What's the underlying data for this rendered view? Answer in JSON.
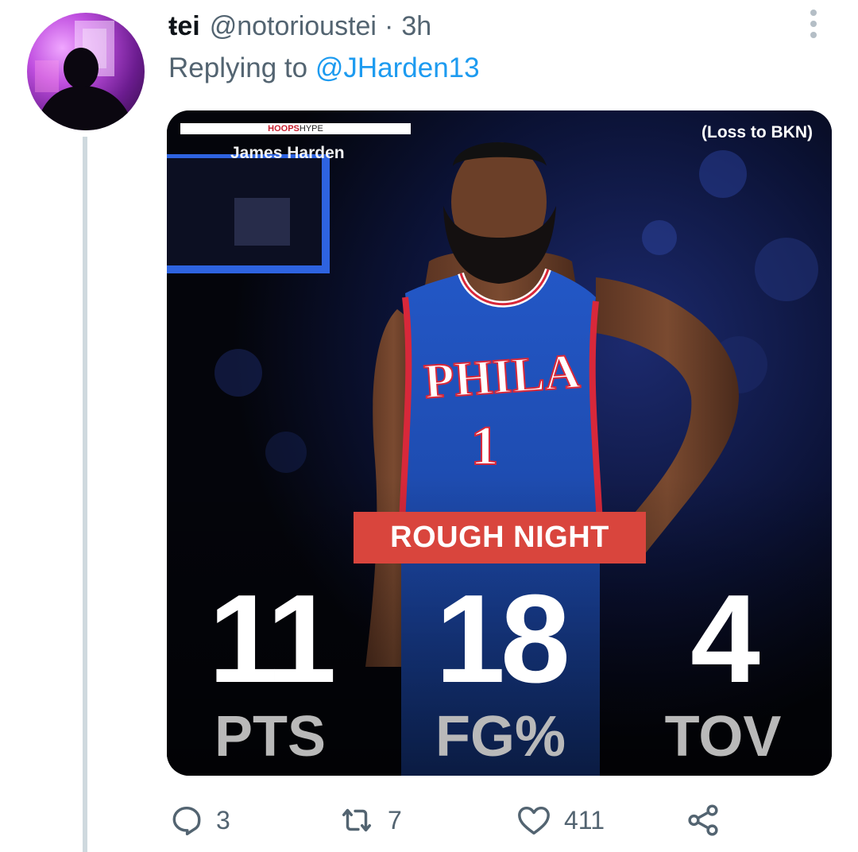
{
  "tweet": {
    "display_name": "ŧei",
    "handle": "@notorioustei",
    "separator": "·",
    "time": "3h",
    "reply_prefix": "Replying to",
    "reply_mention": "@JHarden13"
  },
  "media": {
    "brand": "HOOPS",
    "brand_suffix": "HYPE",
    "player_name": "James Harden",
    "game_result": "(Loss to BKN)",
    "banner": "ROUGH NIGHT",
    "jersey_text": "PHILA",
    "jersey_number": "1",
    "stats": [
      {
        "value": "11",
        "label": "PTS"
      },
      {
        "value": "18",
        "label": "FG%"
      },
      {
        "value": "4",
        "label": "TOV"
      }
    ]
  },
  "actions": {
    "replies": "3",
    "retweets": "7",
    "likes": "411"
  },
  "icons": {
    "more": "more-vertical-icon",
    "reply": "reply-icon",
    "retweet": "retweet-icon",
    "like": "heart-icon",
    "share": "share-icon"
  },
  "colors": {
    "link": "#1d9bf0",
    "muted": "#536471",
    "banner": "#d9453d",
    "jersey": "#1f4fb5"
  }
}
